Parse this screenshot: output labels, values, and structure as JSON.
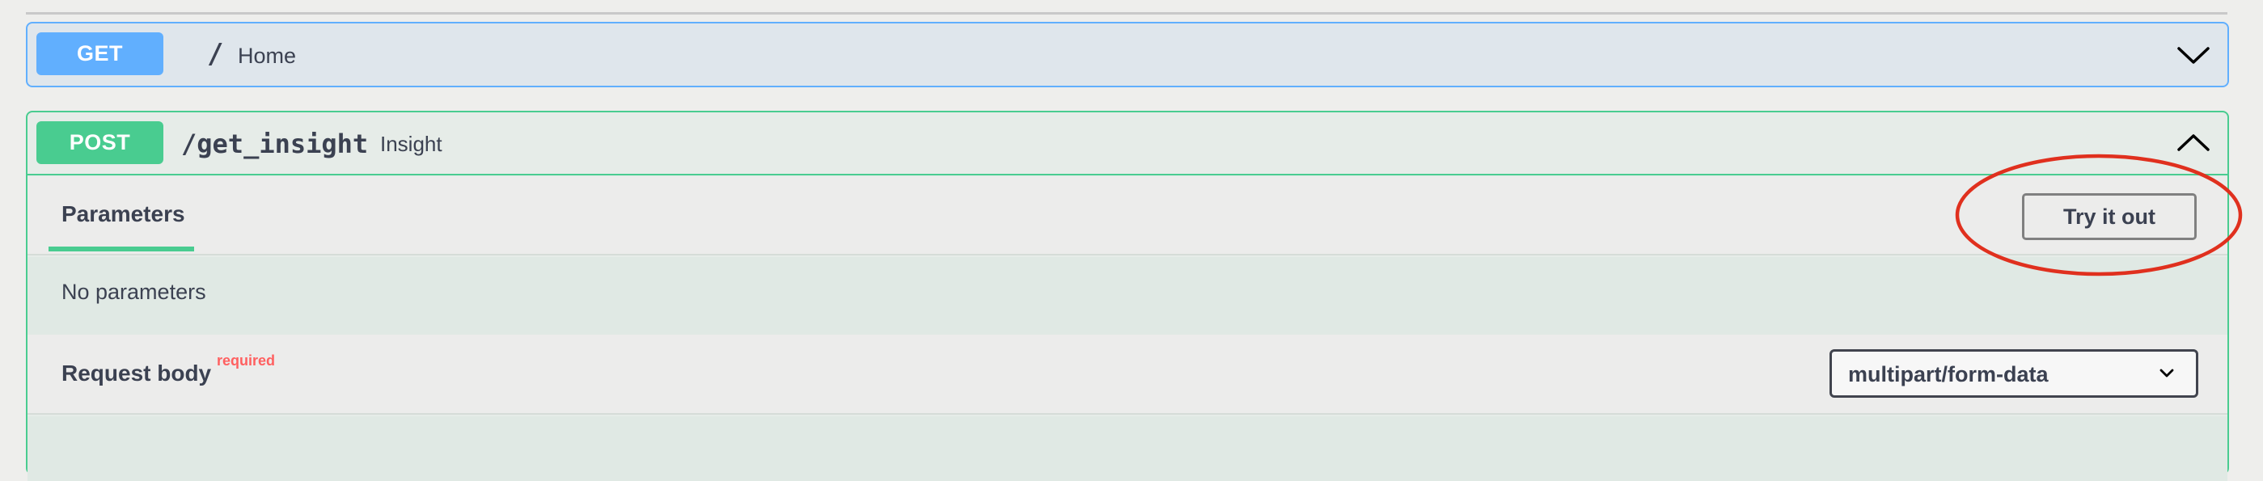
{
  "get_operation": {
    "method": "GET",
    "path": "/",
    "summary": "Home"
  },
  "post_operation": {
    "method": "POST",
    "path": "/get_insight",
    "summary": "Insight",
    "tabs": {
      "parameters": "Parameters"
    },
    "try_it_out": "Try it out",
    "no_parameters": "No parameters",
    "request_body": {
      "label": "Request body",
      "required": "required",
      "content_type": "multipart/form-data"
    }
  },
  "colors": {
    "get_accent": "#61affe",
    "post_accent": "#49cc90",
    "annotation": "#e0301e",
    "required_text": "#ff6060"
  },
  "icons": {
    "get_toggle": "chevron-down-icon",
    "post_toggle": "chevron-up-icon",
    "select_caret": "chevron-down-icon"
  }
}
